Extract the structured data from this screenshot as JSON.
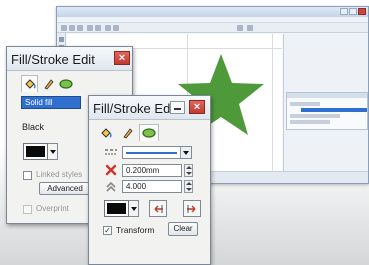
{
  "colors": {
    "star": "#4e9a3a",
    "selection": "#2f6fd0",
    "fill_swatch": "#0a0a0a",
    "close_button": "#c8463c"
  },
  "back_dialog": {
    "title": "Fill/Stroke Edit",
    "close_glyph": "×",
    "tabs": [
      "bucket-icon",
      "pen-icon",
      "stroke-style-icon"
    ],
    "fill_type_value": "Solid fill",
    "color_name": "Black",
    "checkbox1_label": "Linked styles",
    "advanced_button": "Advanced",
    "checkbox2_label": "Overprint"
  },
  "front_dialog": {
    "title": "Fill/Stroke Edit",
    "close_glyph": "×",
    "tabs": [
      "bucket-icon",
      "pen-icon",
      "stroke-style-icon"
    ],
    "width_value": "0.200mm",
    "miter_value": "4.000",
    "transform_label": "Transform",
    "transform_checked": true,
    "clear_button": "Clear"
  }
}
